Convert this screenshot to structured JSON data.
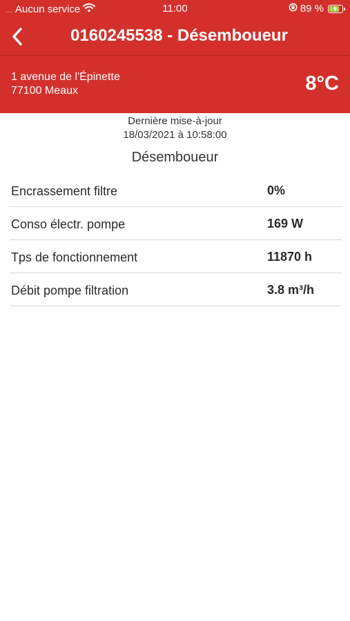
{
  "status_bar": {
    "signal_dots": "....",
    "carrier": "Aucun service",
    "time": "11:00",
    "battery_percent": "89 %",
    "battery_level": 0.89
  },
  "nav": {
    "title": "0160245538 - Désemboueur"
  },
  "site": {
    "address_line1": "1 avenue de l'Épinette",
    "address_line2": "77100 Meaux",
    "temperature": "8°C"
  },
  "update": {
    "label": "Dernière mise-à-jour",
    "datetime": "18/03/2021 à 10:58:00"
  },
  "section": {
    "title": "Désemboueur"
  },
  "rows": [
    {
      "label": "Encrassement filtre",
      "value": "0%"
    },
    {
      "label": "Conso électr. pompe",
      "value": "169 W"
    },
    {
      "label": "Tps de fonctionnement",
      "value": "11870 h"
    },
    {
      "label": "Débit pompe filtration",
      "value": "3.8 m³/h"
    }
  ],
  "colors": {
    "header_red": "#d3302c",
    "battery_green": "#9be04a"
  },
  "icons": {
    "wifi": "wifi-icon",
    "orientation_lock": "orientation-lock-icon",
    "battery": "battery-charging-icon",
    "back": "back-chevron-icon"
  }
}
